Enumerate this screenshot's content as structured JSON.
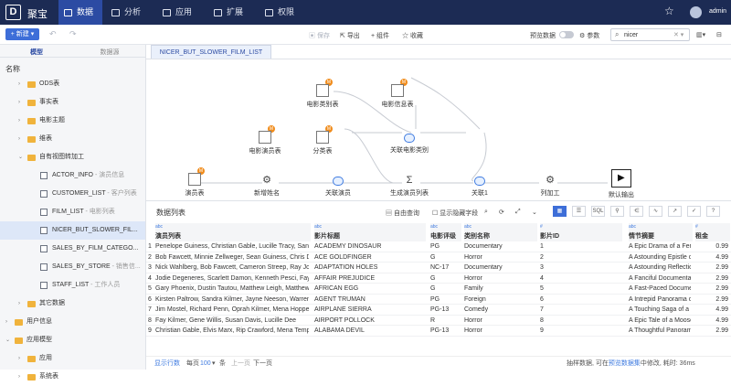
{
  "app": {
    "logo": "D",
    "name": "聚宝",
    "user": "admin"
  },
  "nav": [
    {
      "label": "数据",
      "active": true
    },
    {
      "label": "分析"
    },
    {
      "label": "应用"
    },
    {
      "label": "扩展"
    },
    {
      "label": "权限"
    }
  ],
  "toolbar": {
    "new": "+ 新建 ▾",
    "save": "保存",
    "export": "导出",
    "add_component": "+ 组件",
    "favorite": "收藏",
    "preview": "预览数据",
    "params": "参数",
    "search": "nicer"
  },
  "left": {
    "tabs": [
      "模型",
      "数据源"
    ],
    "heading": "名称",
    "tree": [
      {
        "label": "ODS表",
        "type": "folder",
        "indent": 1
      },
      {
        "label": "事实表",
        "type": "folder",
        "indent": 1
      },
      {
        "label": "电影主题",
        "type": "folder",
        "indent": 1
      },
      {
        "label": "维表",
        "type": "folder",
        "indent": 1
      },
      {
        "label": "自有视图转加工",
        "type": "folder",
        "indent": 1,
        "open": true
      },
      {
        "label": "ACTOR_INFO",
        "sub": " - 演员信息",
        "type": "table",
        "indent": 2
      },
      {
        "label": "CUSTOMER_LIST",
        "sub": " - 客户列表",
        "type": "table",
        "indent": 2
      },
      {
        "label": "FILM_LIST",
        "sub": " - 电影列表",
        "type": "table",
        "indent": 2
      },
      {
        "label": "NICER_BUT_SLOWER_FIL...",
        "type": "table",
        "indent": 2,
        "selected": true
      },
      {
        "label": "SALES_BY_FILM_CATEGO...",
        "type": "table",
        "indent": 2
      },
      {
        "label": "SALES_BY_STORE",
        "sub": " - 销售信...",
        "type": "table",
        "indent": 2
      },
      {
        "label": "STAFF_LIST",
        "sub": " - 工作人员",
        "type": "table",
        "indent": 2
      },
      {
        "label": "其它数据",
        "type": "folder",
        "indent": 1
      },
      {
        "label": "用户信息",
        "type": "folder",
        "indent": 0
      },
      {
        "label": "应用模型",
        "type": "folder",
        "indent": 0,
        "open": true
      },
      {
        "label": "应用",
        "type": "folder",
        "indent": 1
      },
      {
        "label": "系统表",
        "type": "folder",
        "indent": 1
      }
    ]
  },
  "tab": "NICER_BUT_SLOWER_FILM_LIST",
  "flow": {
    "nodes": {
      "film_cat": "电影类别表",
      "film_info": "电影信息表",
      "film_actor": "电影演员表",
      "category": "分类表",
      "assoc_film_cat": "关联电影类别",
      "actor": "演员表",
      "new_name": "新增姓名",
      "join_actor": "关联演员",
      "gen_actor_list": "生成演员列表",
      "join1": "关联1",
      "col_proc": "列加工",
      "output": "默认输出"
    }
  },
  "data": {
    "title": "数据列表",
    "auto_query": "自由查询",
    "show_hidden": "显示隐藏字段",
    "columns": [
      {
        "type": "abc",
        "name": "演员列表"
      },
      {
        "type": "abc",
        "name": "影片标题"
      },
      {
        "type": "abc",
        "name": "电影评级"
      },
      {
        "type": "abc",
        "name": "类别名称"
      },
      {
        "type": "#",
        "name": "影片ID"
      },
      {
        "type": "abc",
        "name": "情节摘要"
      },
      {
        "type": "#",
        "name": "租金"
      }
    ],
    "rows": [
      [
        "1",
        "Penelope Guiness, Christian Gable, Lucille Tracy, Sandra",
        "ACADEMY DINOSAUR",
        "PG",
        "Documentary",
        "1",
        "A Epic Drama of a Feminist And a Mad Scientist who must",
        "0.99"
      ],
      [
        "2",
        "Bob Fawcett, Minnie Zellweger, Sean Guiness, Chris Dep",
        "ACE GOLDFINGER",
        "G",
        "Horror",
        "2",
        "A Astounding Epistle of a Database Administrator And a E",
        "4.99"
      ],
      [
        "3",
        "Nick Wahlberg, Bob Fawcett, Cameron Streep, Ray Johan",
        "ADAPTATION HOLES",
        "NC-17",
        "Documentary",
        "3",
        "A Astounding Reflection of a Lumberjack And a Car who m",
        "2.99"
      ],
      [
        "4",
        "Jodie Degeneres, Scarlett Damon, Kenneth Pesci, Fay Wi",
        "AFFAIR PREJUDICE",
        "G",
        "Horror",
        "4",
        "A Fanciful Documentary of a Frisbee And a Lumberjack wh",
        "2.99"
      ],
      [
        "5",
        "Gary Phoenix, Dustin Tautou, Matthew Leigh, Matthew Ca",
        "AFRICAN EGG",
        "G",
        "Family",
        "5",
        "A Fast-Paced Documentary of a Pastry Chef And a Dentis",
        "2.99"
      ],
      [
        "6",
        "Kirsten Paltrow, Sandra Kilmer, Jayne Neeson, Warren N",
        "AGENT TRUMAN",
        "PG",
        "Foreign",
        "6",
        "A Intrepid Panorama of a Robot And a Boy who must Esca",
        "2.99"
      ],
      [
        "7",
        "Jim Mostel, Richard Penn, Oprah Kilmer, Mena Hopper, M",
        "AIRPLANE SIERRA",
        "PG-13",
        "Comedy",
        "7",
        "A Touching Saga of a Hunter And a Butler who must Disco",
        "4.99"
      ],
      [
        "8",
        "Fay Kilmer, Gene Willis, Susan Davis, Lucille Dee",
        "AIRPORT POLLOCK",
        "R",
        "Horror",
        "8",
        "A Epic Tale of a Moose And a Girl who must Confront a M",
        "4.99"
      ],
      [
        "9",
        "Christian Gable, Elvis Marx, Rip Crawford, Mena Temple,",
        "ALABAMA DEVIL",
        "PG-13",
        "Horror",
        "9",
        "A Thoughtful Panorama of a Database Administrator And a",
        "2.99"
      ]
    ],
    "footer": {
      "show_rows": "显示行数",
      "per_page": "每页",
      "per_page_n": "100",
      "per_page_unit": "条",
      "prev": "上一页",
      "next": "下一页",
      "status": "抽样数据, 可在",
      "status_link": "预览数据集",
      "status_end": "中修改, 耗时: 36ms"
    }
  }
}
